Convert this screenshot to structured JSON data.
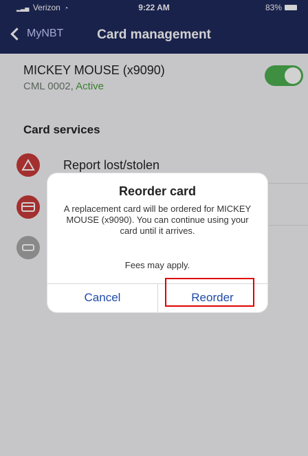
{
  "status_bar": {
    "carrier": "Verizon",
    "time": "9:22 AM",
    "battery": "83%"
  },
  "nav": {
    "back_label": "MyNBT",
    "title": "Card management"
  },
  "account": {
    "name": "MICKEY MOUSE (x9090)",
    "code": "CML 0002,",
    "status": "Active",
    "enabled": true
  },
  "services": {
    "title": "Card services",
    "items": [
      {
        "label": "Report lost/stolen",
        "icon": "warning-icon"
      },
      {
        "label": "",
        "icon": "card-icon"
      },
      {
        "label": "",
        "icon": "gray-card-icon"
      }
    ]
  },
  "dialog": {
    "title": "Reorder card",
    "message": "A replacement card will be ordered for MICKEY MOUSE (x9090). You can continue using your card until it arrives.",
    "fees": "Fees may apply.",
    "cancel_label": "Cancel",
    "reorder_label": "Reorder"
  },
  "colors": {
    "header": "#1f2a5c",
    "accent": "#1f4aa7",
    "danger": "#c93a3a",
    "success": "#4caf50",
    "highlight": "#e00000"
  }
}
